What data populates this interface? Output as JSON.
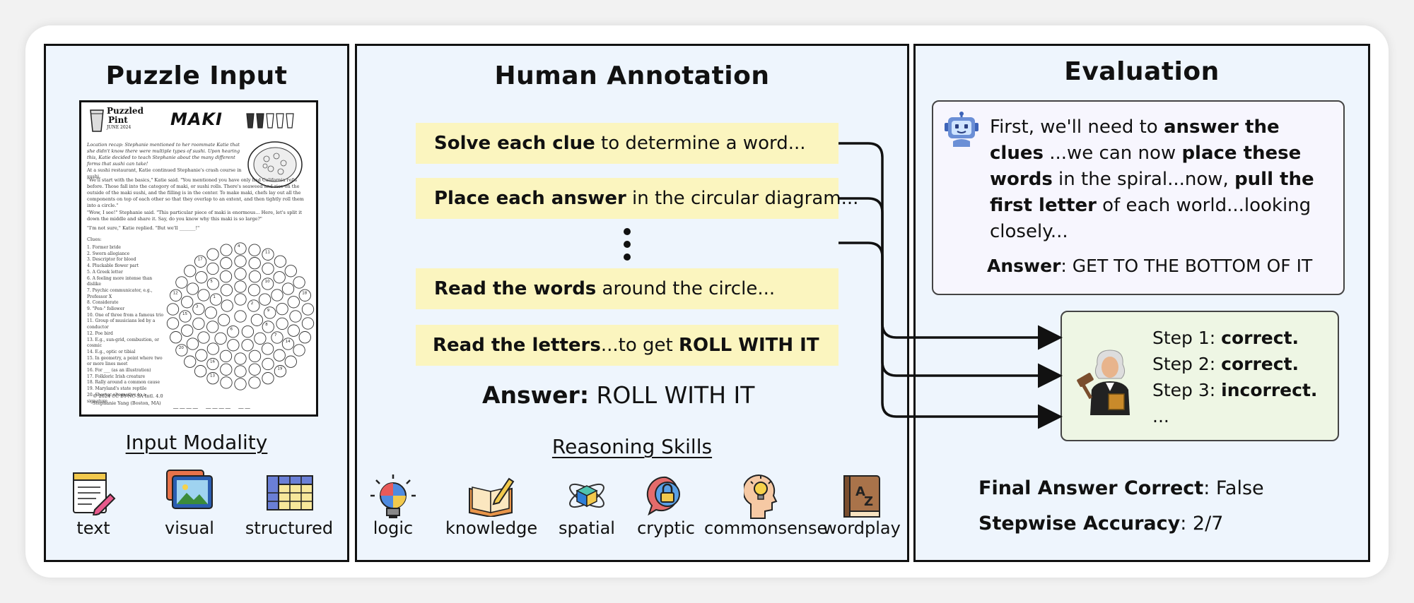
{
  "panels": {
    "input": {
      "title": "Puzzle Input",
      "modality_heading": "Input Modality",
      "modalities": [
        {
          "label": "text",
          "icon": "notepad-pencil-icon"
        },
        {
          "label": "visual",
          "icon": "photo-gallery-icon"
        },
        {
          "label": "structured",
          "icon": "table-grid-icon"
        }
      ],
      "puzzle_page": {
        "brand_line1": "Puzzled",
        "brand_line2": "Pint",
        "date": "JUNE 2024",
        "puzzle_title": "MAKI",
        "intro": "Location recap: Stephanie mentioned to her roommate Katie that she didn't know there were multiple types of sushi. Upon hearing this, Katie decided to teach Stephanie about the many different forms that sushi can take!",
        "para2": "At a sushi restaurant, Katie continued Stephanie's crash course in sushi.",
        "para3": "\"We'll start with the basics,\" Katie said. \"You mentioned you have only had California rolls before. Those fall into the category of maki, or sushi rolls. There's seaweed and rice on the outside of the maki sushi, and the filling is in the center. To make maki, chefs lay out all the components on top of each other so that they overlap to an extent, and then tightly roll them into a circle.\"",
        "para4": "\"Wow, I see!\" Stephanie said. \"This particular piece of maki is enormous... Here, let's split it down the middle and share it. Say, do you know why this maki is so large?\"",
        "para5": "\"I'm not sure,\" Katie replied. \"But we'll _______!\"",
        "clues_heading": "Clues:",
        "clues": [
          "1. Former bride",
          "2. Sworn allegiance",
          "3. Descriptor for blood",
          "4. Pluckable flower part",
          "5. A Greek letter",
          "6. A feeling more intense than dislike",
          "7. Psychic communicator, e.g., Professor X",
          "8. Considerate",
          "9. \"Pen-\" follower",
          "10. One of three from a famous trio",
          "11. Group of musicians led by a conductor",
          "12. Poe bird",
          "13. E.g., sun-grid, combustion, or cosmic",
          "14. E.g., optic or tibial",
          "15. In geometry, a point where two or more lines meet",
          "16. For ___ (as an illustration)",
          "17. Folkloric Irish creature",
          "18. Rally around a common cause",
          "19. Maryland's state reptile",
          "20. Shorter alternative to a signature"
        ],
        "footer1": "© 2024 CC BY-NC-SA Intl. 4.0",
        "footer2": "Stephanie Yang (Boston, MA)",
        "blanks": "____ ____ __",
        "grid_numbers": [
          "17",
          "11",
          "18",
          "10",
          "7",
          "5",
          "16",
          "1",
          "8",
          "19",
          "2",
          "6",
          "4",
          "3",
          "9",
          "12",
          "15",
          "13",
          "14",
          "20"
        ]
      }
    },
    "annotation": {
      "title": "Human Annotation",
      "steps": [
        {
          "bold": "Solve each clue",
          "rest": " to determine a word..."
        },
        {
          "bold": "Place each answer",
          "rest": " in the circular diagram..."
        },
        {
          "bold": "Read the words",
          "rest": " around the circle..."
        },
        {
          "bold": "Read the letters",
          "rest": "...to get ",
          "bold2": "ROLL WITH IT"
        }
      ],
      "answer_label": "Answer:",
      "answer_value": " ROLL WITH IT",
      "skills_heading": "Reasoning Skills",
      "skills": [
        {
          "label": "logic",
          "icon": "lightbulb-puzzle-icon"
        },
        {
          "label": "knowledge",
          "icon": "open-book-pencil-icon"
        },
        {
          "label": "spatial",
          "icon": "cube-orbit-icon"
        },
        {
          "label": "cryptic",
          "icon": "lock-speech-icon"
        },
        {
          "label": "commonsense",
          "icon": "head-lightbulb-icon"
        },
        {
          "label": "wordplay",
          "icon": "dictionary-az-icon"
        }
      ]
    },
    "evaluation": {
      "title": "Evaluation",
      "model_parts": [
        {
          "t": "First, we'll need to ",
          "b": false
        },
        {
          "t": "answer the clues",
          "b": true
        },
        {
          "t": " ...we can now ",
          "b": false
        },
        {
          "t": "place these words",
          "b": true
        },
        {
          "t": " in the spiral...now, ",
          "b": false
        },
        {
          "t": "pull the first letter",
          "b": true
        },
        {
          "t": " of each world...looking closely...",
          "b": false
        }
      ],
      "model_answer_label": "Answer",
      "model_answer_value": ": GET TO THE BOTTOM OF IT",
      "judge_steps": [
        {
          "label": "Step 1: ",
          "verdict": "correct."
        },
        {
          "label": "Step 2: ",
          "verdict": "correct."
        },
        {
          "label": "Step 3: ",
          "verdict": "incorrect."
        }
      ],
      "judge_more": "...",
      "final_label": "Final Answer Correct",
      "final_value": ": False",
      "stepwise_label": "Stepwise Accuracy",
      "stepwise_value": ": 2/7"
    }
  },
  "colors": {
    "panel_bg": "#eef5fd",
    "step_bg": "#fbf5bf",
    "bubble_bg": "#f7f6fe",
    "judge_bg": "#eef6e4",
    "robot": "#6b8fd6"
  }
}
